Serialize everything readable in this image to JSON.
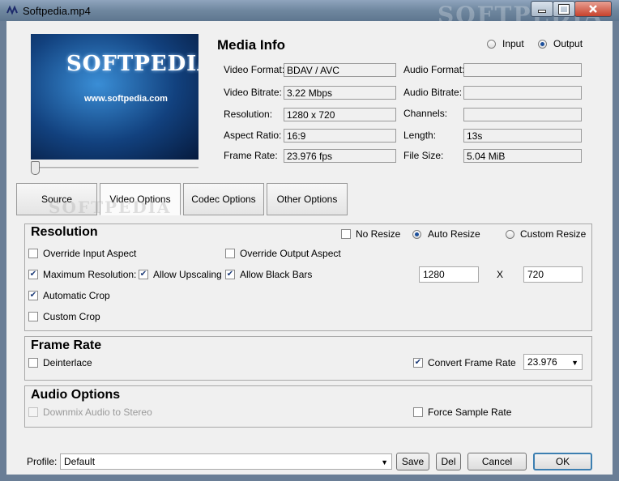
{
  "window": {
    "title": "Softpedia.mp4",
    "watermark": "SOFTPEDIA"
  },
  "thumbnail": {
    "logo": "SOFTPEDIA™",
    "url": "www.softpedia.com"
  },
  "media_info": {
    "heading": "Media Info",
    "mode_options": [
      {
        "label": "Input",
        "selected": false
      },
      {
        "label": "Output",
        "selected": true
      }
    ],
    "left_fields": [
      {
        "label": "Video Format:",
        "value": "BDAV / AVC"
      },
      {
        "label": "Video Bitrate:",
        "value": "3.22 Mbps"
      },
      {
        "label": "Resolution:",
        "value": "1280 x 720"
      },
      {
        "label": "Aspect Ratio:",
        "value": "16:9"
      },
      {
        "label": "Frame Rate:",
        "value": "23.976 fps"
      }
    ],
    "right_fields": [
      {
        "label": "Audio Format:",
        "value": ""
      },
      {
        "label": "Audio Bitrate:",
        "value": ""
      },
      {
        "label": "Channels:",
        "value": ""
      },
      {
        "label": "Length:",
        "value": "13s"
      },
      {
        "label": "File Size:",
        "value": "5.04 MiB"
      }
    ]
  },
  "tabs": [
    {
      "label": "Source"
    },
    {
      "label": "Video Options"
    },
    {
      "label": "Codec Options"
    },
    {
      "label": "Other Options"
    }
  ],
  "tab_watermark": "SOFTPEDIA",
  "resolution": {
    "title": "Resolution",
    "resize_no": "No Resize",
    "resize_auto": "Auto Resize",
    "resize_custom": "Custom Resize",
    "override_input_aspect": "Override Input Aspect",
    "override_output_aspect": "Override Output Aspect",
    "max_resolution": "Maximum Resolution:",
    "allow_upscaling": "Allow Upscaling",
    "allow_black_bars": "Allow Black Bars",
    "width": "1280",
    "x_sep": "X",
    "height": "720",
    "automatic_crop": "Automatic Crop",
    "custom_crop": "Custom Crop"
  },
  "frame_rate": {
    "title": "Frame Rate",
    "deinterlace": "Deinterlace",
    "convert_frame_rate": "Convert Frame Rate",
    "rate_value": "23.976"
  },
  "audio": {
    "title": "Audio Options",
    "downmix": "Downmix Audio to Stereo",
    "force_sample_rate": "Force Sample Rate"
  },
  "footer": {
    "profile_label": "Profile:",
    "profile_value": "Default",
    "save": "Save",
    "del": "Del",
    "cancel": "Cancel",
    "ok": "OK"
  },
  "colors": {
    "title_bar": "#6f879f",
    "accent": "#3c7fb1",
    "thumb_blue": "#12417e"
  }
}
